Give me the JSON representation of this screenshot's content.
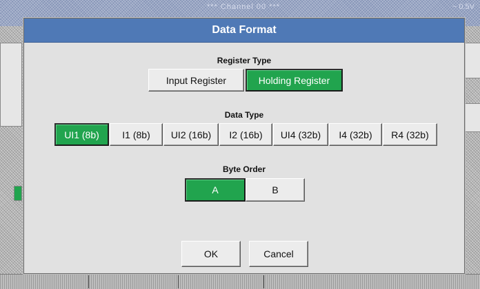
{
  "background": {
    "title": "*** Channel 00 ***",
    "title_right": "~ 0.5V"
  },
  "dialog": {
    "title": "Data Format",
    "register_type": {
      "label": "Register Type",
      "options": [
        "Input Register",
        "Holding Register"
      ],
      "selected": "Holding Register"
    },
    "data_type": {
      "label": "Data Type",
      "options": [
        "UI1 (8b)",
        "I1 (8b)",
        "UI2 (16b)",
        "I2 (16b)",
        "UI4 (32b)",
        "I4 (32b)",
        "R4 (32b)"
      ],
      "selected": "UI1 (8b)"
    },
    "byte_order": {
      "label": "Byte Order",
      "options": [
        "A",
        "B"
      ],
      "selected": "A"
    },
    "ok_label": "OK",
    "cancel_label": "Cancel"
  },
  "colors": {
    "header": "#4f79b6",
    "selected": "#21a44e",
    "dialog_bg": "#e1e1e1"
  }
}
